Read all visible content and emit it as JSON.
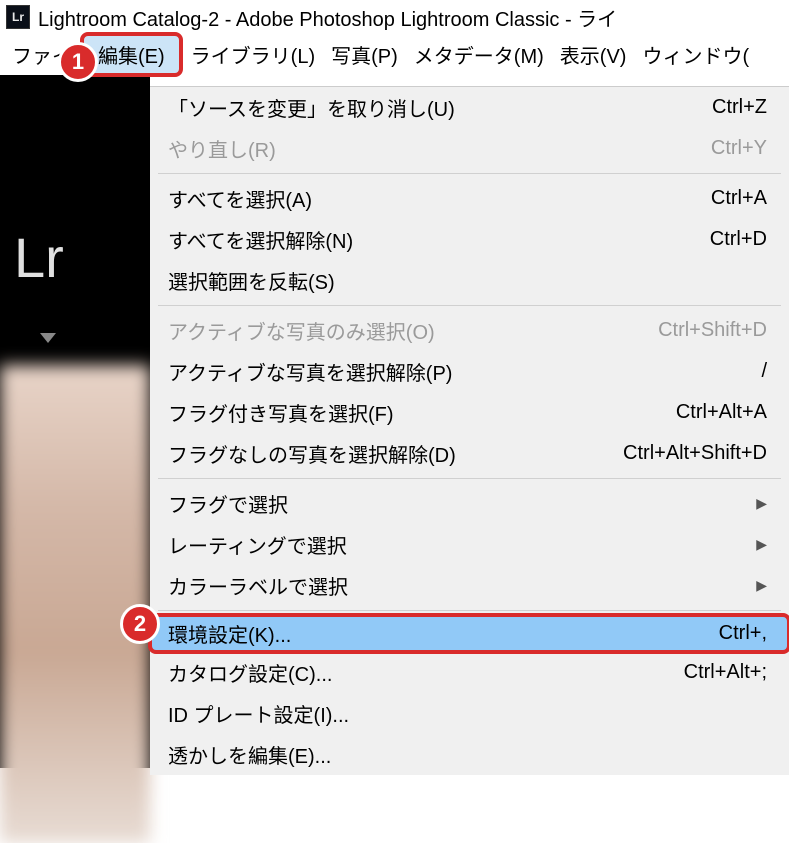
{
  "titlebar": {
    "icon_text": "Lr",
    "title": "Lightroom Catalog-2 - Adobe Photoshop Lightroom Classic - ライ"
  },
  "menubar": {
    "file": "ファイ",
    "edit": "編集(E)",
    "library": "ライブラリ(L)",
    "photo": "写真(P)",
    "metadata": "メタデータ(M)",
    "view": "表示(V)",
    "window": "ウィンドウ("
  },
  "callouts": {
    "one": "1",
    "two": "2"
  },
  "sidebar": {
    "logo": "Lr"
  },
  "dropdown": {
    "undo": {
      "label": "「ソースを変更」を取り消し(U)",
      "shortcut": "Ctrl+Z"
    },
    "redo": {
      "label": "やり直し(R)",
      "shortcut": "Ctrl+Y"
    },
    "select_all": {
      "label": "すべてを選択(A)",
      "shortcut": "Ctrl+A"
    },
    "select_none": {
      "label": "すべてを選択解除(N)",
      "shortcut": "Ctrl+D"
    },
    "invert_selection": {
      "label": "選択範囲を反転(S)",
      "shortcut": ""
    },
    "select_active_only": {
      "label": "アクティブな写真のみ選択(O)",
      "shortcut": "Ctrl+Shift+D"
    },
    "deselect_active": {
      "label": "アクティブな写真を選択解除(P)",
      "shortcut": "/"
    },
    "select_flagged": {
      "label": "フラグ付き写真を選択(F)",
      "shortcut": "Ctrl+Alt+A"
    },
    "deselect_unflagged": {
      "label": "フラグなしの写真を選択解除(D)",
      "shortcut": "Ctrl+Alt+Shift+D"
    },
    "select_by_flag": {
      "label": "フラグで選択",
      "arrow": "▶"
    },
    "select_by_rating": {
      "label": "レーティングで選択",
      "arrow": "▶"
    },
    "select_by_color": {
      "label": "カラーラベルで選択",
      "arrow": "▶"
    },
    "preferences": {
      "label": "環境設定(K)...",
      "shortcut": "Ctrl+,"
    },
    "catalog_settings": {
      "label": "カタログ設定(C)...",
      "shortcut": "Ctrl+Alt+;"
    },
    "id_plate": {
      "label": "ID プレート設定(I)...",
      "shortcut": ""
    },
    "edit_watermarks": {
      "label": "透かしを編集(E)...",
      "shortcut": ""
    }
  }
}
